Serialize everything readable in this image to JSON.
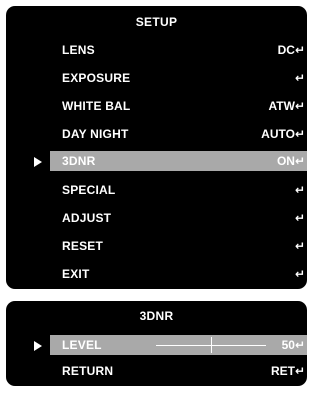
{
  "setup_menu": {
    "title": "SETUP",
    "items": [
      {
        "label": "LENS",
        "value": "DC"
      },
      {
        "label": "EXPOSURE",
        "value": ""
      },
      {
        "label": "WHITE BAL",
        "value": "ATW"
      },
      {
        "label": "DAY NIGHT",
        "value": "AUTO"
      },
      {
        "label": "3DNR",
        "value": "ON"
      },
      {
        "label": "SPECIAL",
        "value": ""
      },
      {
        "label": "ADJUST",
        "value": ""
      },
      {
        "label": "RESET",
        "value": ""
      },
      {
        "label": "EXIT",
        "value": ""
      }
    ],
    "selected_index": 4
  },
  "submenu": {
    "title": "3DNR",
    "level_label": "LEVEL",
    "level_value": "50",
    "level_fraction": 0.5,
    "return_label": "RETURN",
    "return_value": "RET"
  },
  "icons": {
    "enter": "enter-icon",
    "cursor": "play-triangle-icon",
    "enter_glyph": "↵"
  },
  "colors": {
    "panel_background": "#000000",
    "text": "#ffffff",
    "selection_bar": "#a9a9a9"
  }
}
